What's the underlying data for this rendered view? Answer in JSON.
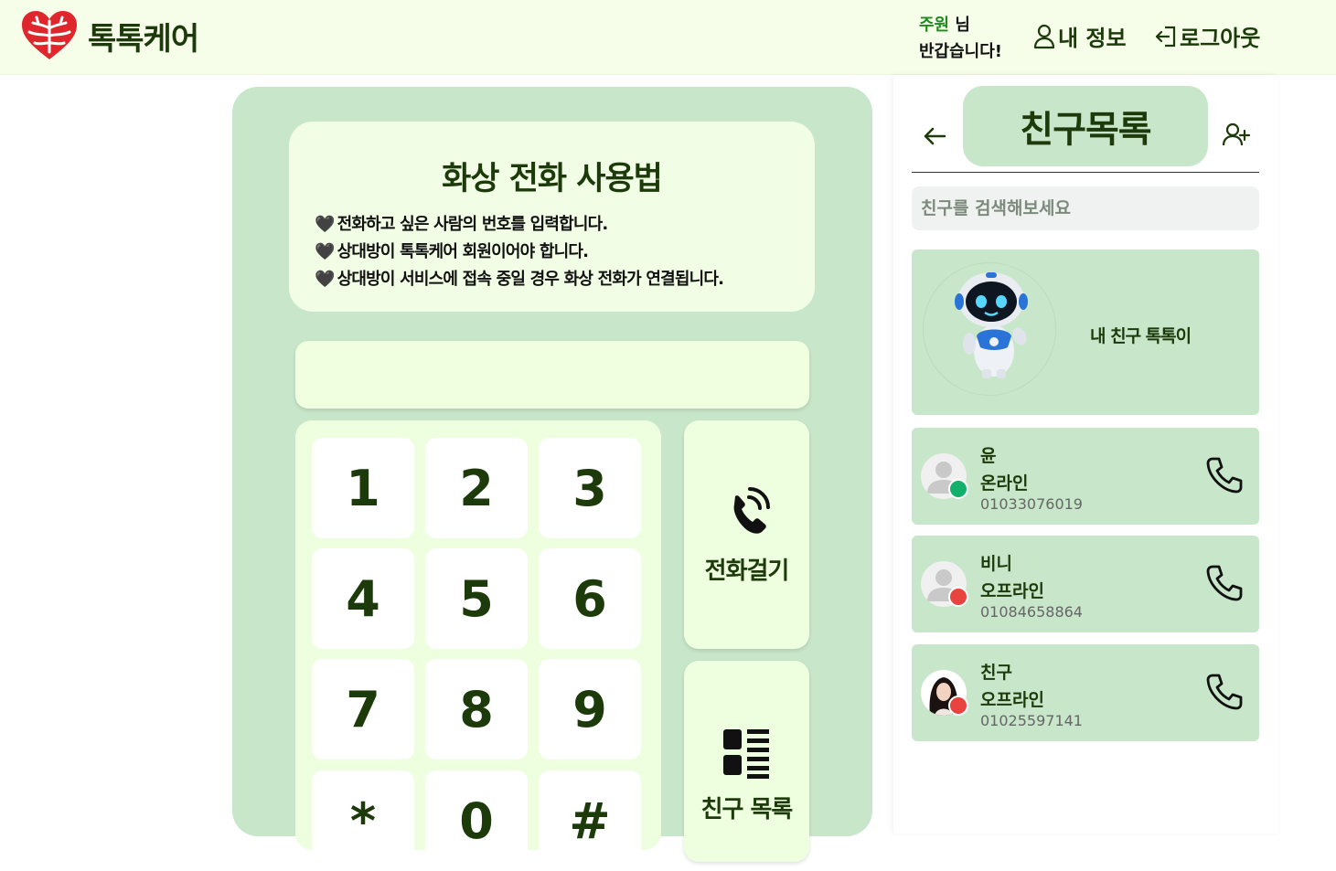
{
  "app": {
    "logo_text": "톡톡케어",
    "user_name": "주원",
    "user_suffix": " 님",
    "greeting": "반갑습니다!",
    "nav_my_info": "내 정보",
    "nav_logout": "로그아웃"
  },
  "guide": {
    "title": "화상 전화 사용법",
    "bullet": "🖤",
    "items": [
      "전화하고 싶은 사람의 번호를 입력합니다.",
      "상대방이 톡톡케어 회원이어야 합니다.",
      "상대방이 서비스에 접속 중일 경우 화상 전화가 연결됩니다."
    ]
  },
  "dialer": {
    "number_value": "",
    "keys": [
      "1",
      "2",
      "3",
      "4",
      "5",
      "6",
      "7",
      "8",
      "9",
      "*",
      "0",
      "#"
    ],
    "call_label": "전화걸기",
    "friends_label": "친구 목록"
  },
  "friends_panel": {
    "title": "친구목록",
    "search_placeholder": "친구를 검색해보세요",
    "bot_label": "내 친구 톡톡이",
    "friends": [
      {
        "name": "윤",
        "status": "온라인",
        "phone": "01033076019",
        "status_color": "#13b06b"
      },
      {
        "name": "비니",
        "status": "오프라인",
        "phone": "01084658864",
        "status_color": "#e8433f"
      },
      {
        "name": "친구",
        "status": "오프라인",
        "phone": "01025597141",
        "status_color": "#e8433f"
      }
    ]
  },
  "colors": {
    "brand_green": "#c8e6c9",
    "text_dark_green": "#1c3a0a",
    "header_bg": "#f6fde9",
    "logo_red": "#e0262d",
    "online": "#13b06b",
    "offline": "#e8433f"
  }
}
